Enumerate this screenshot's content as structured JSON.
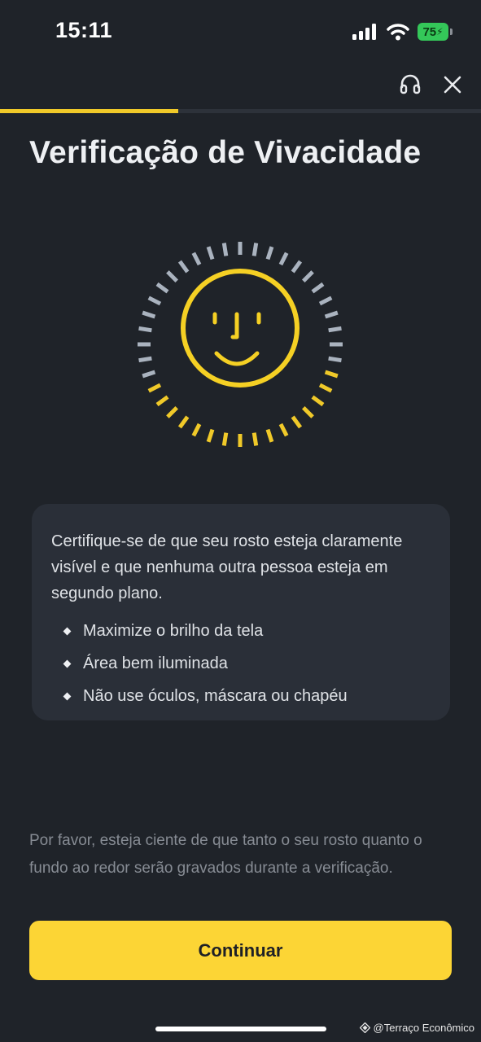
{
  "status_bar": {
    "time": "15:11",
    "battery_level": "75",
    "icons": [
      "cellular-signal-icon",
      "wifi-icon",
      "battery-charging-icon"
    ]
  },
  "header": {
    "icons": [
      "headset-support-icon",
      "close-icon"
    ]
  },
  "progress": {
    "fraction": 0.37
  },
  "title": "Verificação de Vivacidade",
  "face_scan": {
    "icon": "smiley-face-icon",
    "ticks_total": 40,
    "ticks_completed": 16
  },
  "info_card": {
    "description": "Certifique-se de que seu rosto esteja claramente visível e que nenhuma outra pessoa esteja em segundo plano.",
    "tips": [
      "Maximize o brilho da tela",
      "Área bem iluminada",
      "Não use óculos, máscara ou chapéu"
    ]
  },
  "notice": "Por favor, esteja ciente de que tanto o seu rosto quanto o fundo ao redor serão gravados durante a verificação.",
  "continue_label": "Continuar",
  "watermark": "@Terraço Econômico",
  "colors": {
    "background": "#1f2329",
    "accent": "#fcd535",
    "card": "#2a2f38",
    "tick_pending": "#aab3bf",
    "tick_done": "#f0c929"
  }
}
